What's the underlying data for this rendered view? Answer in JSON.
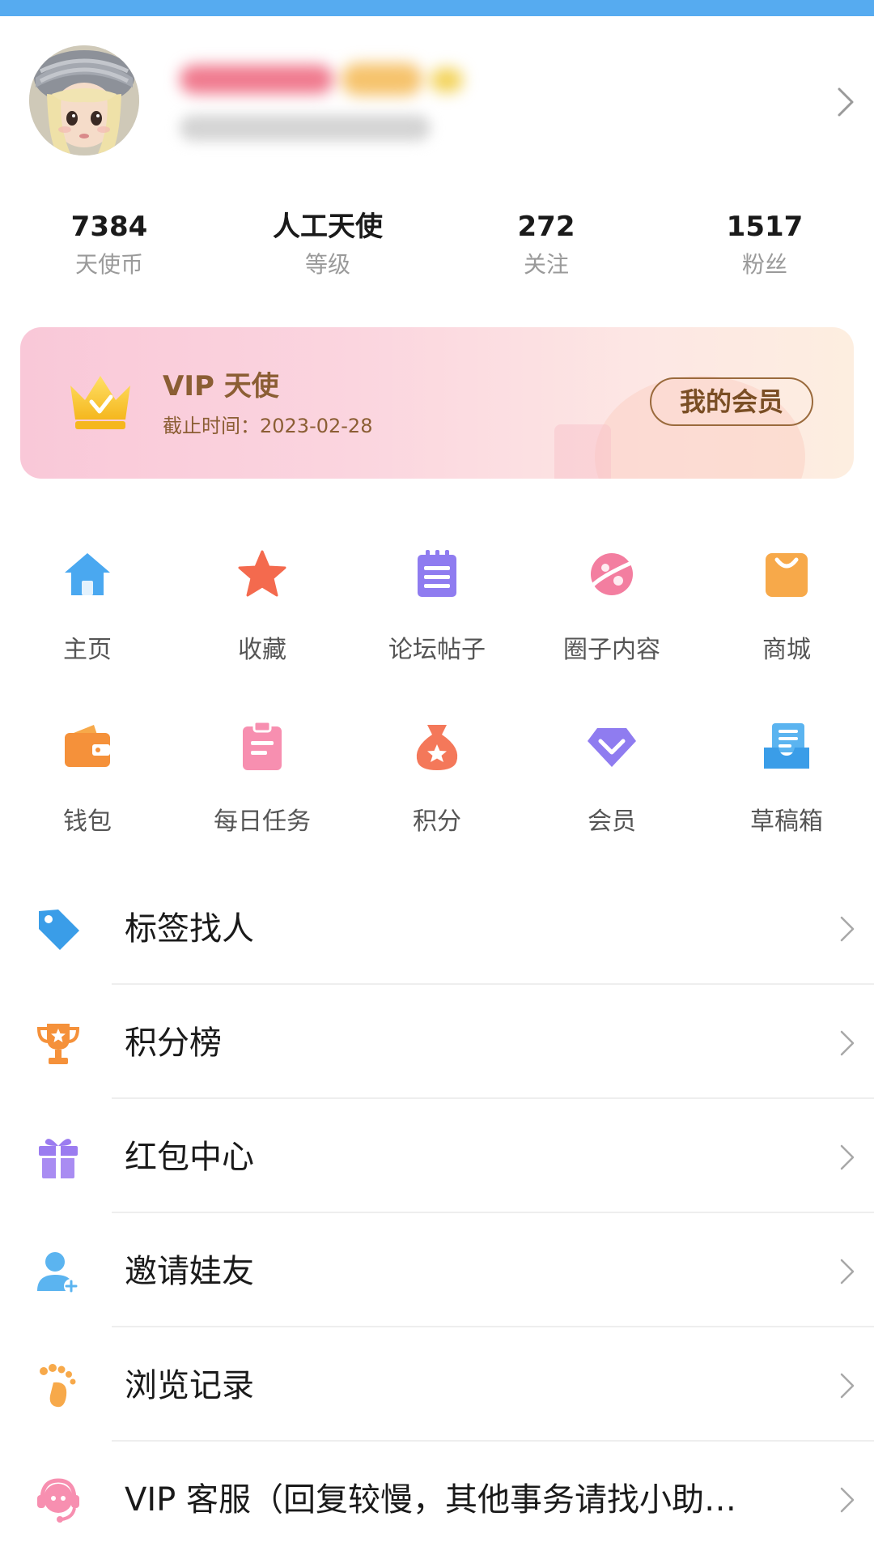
{
  "profile": {
    "stats": [
      {
        "value": "7384",
        "label": "天使币"
      },
      {
        "value": "人工天使",
        "label": "等级"
      },
      {
        "value": "272",
        "label": "关注"
      },
      {
        "value": "1517",
        "label": "粉丝"
      }
    ]
  },
  "vip": {
    "title": "VIP 天使",
    "expire": "截止时间：2023-02-28",
    "button": "我的会员"
  },
  "grid": {
    "row1": [
      {
        "label": "主页",
        "icon": "home-icon"
      },
      {
        "label": "收藏",
        "icon": "star-icon"
      },
      {
        "label": "论坛帖子",
        "icon": "notepad-icon"
      },
      {
        "label": "圈子内容",
        "icon": "planet-icon"
      },
      {
        "label": "商城",
        "icon": "shopping-bag-icon"
      }
    ],
    "row2": [
      {
        "label": "钱包",
        "icon": "wallet-icon"
      },
      {
        "label": "每日任务",
        "icon": "clipboard-icon"
      },
      {
        "label": "积分",
        "icon": "money-bag-icon"
      },
      {
        "label": "会员",
        "icon": "diamond-icon"
      },
      {
        "label": "草稿箱",
        "icon": "inbox-icon"
      }
    ]
  },
  "list": [
    {
      "label": "标签找人",
      "icon": "tag-icon"
    },
    {
      "label": "积分榜",
      "icon": "trophy-icon"
    },
    {
      "label": "红包中心",
      "icon": "gift-icon"
    },
    {
      "label": "邀请娃友",
      "icon": "add-user-icon"
    },
    {
      "label": "浏览记录",
      "icon": "footprint-icon"
    },
    {
      "label": "VIP 客服（回复较慢，其他事务请找小助…",
      "icon": "customer-service-icon"
    }
  ],
  "colors": {
    "top_strip": "#56abf0",
    "vip_text": "#8b5e34",
    "home": "#4aa8f0",
    "star": "#f46a4e",
    "notepad": "#8f7cf0",
    "planet": "#f37ea0",
    "bag": "#f7a94a"
  }
}
